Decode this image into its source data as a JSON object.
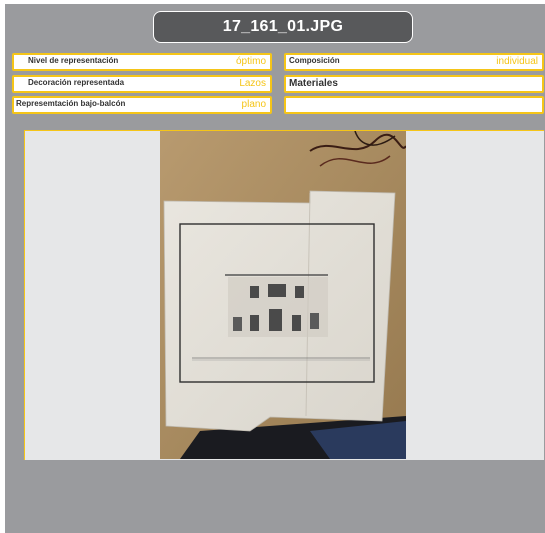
{
  "title": "17_161_01.JPG",
  "left_fields": [
    {
      "label": "Nivel de representación",
      "value": "óptimo"
    },
    {
      "label": "Decoración representada",
      "value": "Lazos"
    },
    {
      "label": "Represemtación bajo-balcón",
      "value": "plano"
    }
  ],
  "right_fields": [
    {
      "label": "Composición",
      "value": "individual"
    },
    {
      "label": "Materiales",
      "value": ""
    },
    {
      "label": "",
      "value": ""
    }
  ],
  "colors": {
    "panel": "#9a9b9e",
    "accent": "#f5c518",
    "title_bg": "#58595b",
    "viewer_bg": "#e6e7e8"
  }
}
